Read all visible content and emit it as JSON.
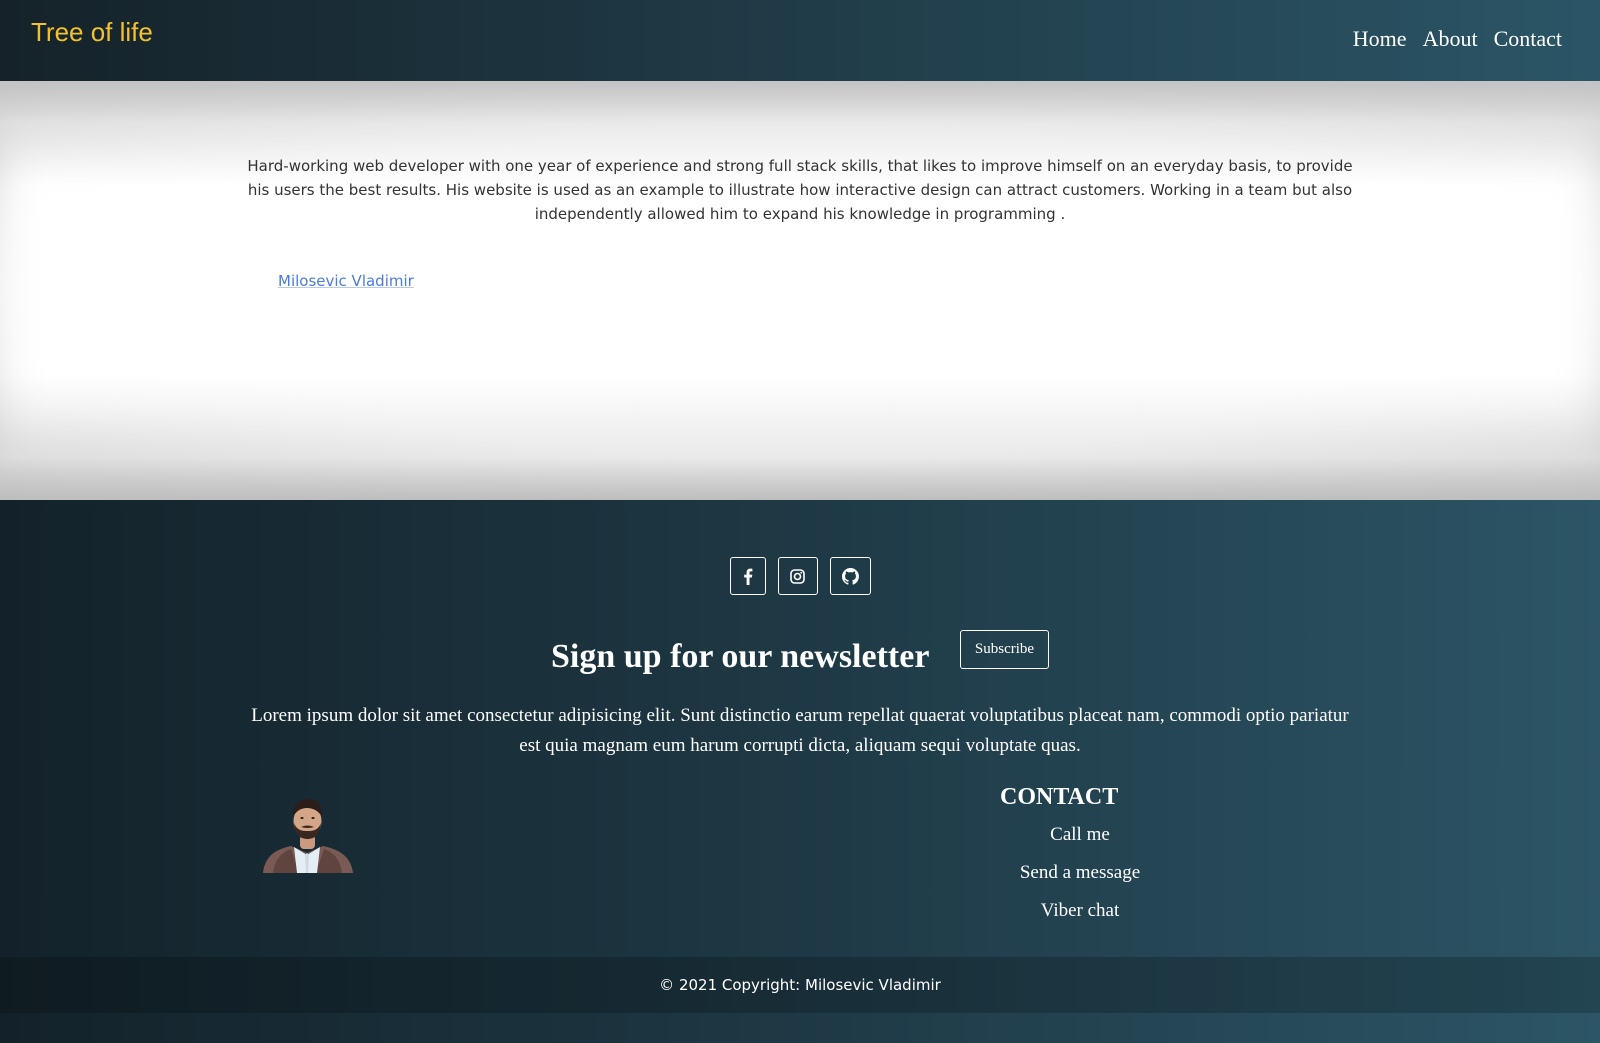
{
  "navbar": {
    "brand": "Tree of life",
    "links": [
      "Home",
      "About",
      "Contact"
    ]
  },
  "about": {
    "description": "Hard-working web developer with one year of experience and strong full stack skills, that likes to improve himself on an everyday basis, to provide his users the best results. His website is used as an example to illustrate how interactive design can attract customers. Working in a team but also independently allowed him to expand his knowledge in programming .",
    "author_link": "Milosevic Vladimir"
  },
  "footer": {
    "social_icons": [
      "facebook-icon",
      "instagram-icon",
      "github-icon"
    ],
    "newsletter_title": "Sign up for our newsletter",
    "subscribe_label": "Subscribe",
    "newsletter_text": "Lorem ipsum dolor sit amet consectetur adipisicing elit. Sunt distinctio earum repellat quaerat voluptatibus placeat nam, commodi optio pariatur est quia magnam eum harum corrupti dicta, aliquam sequi voluptate quas.",
    "contact_title": "CONTACT",
    "contact_items": [
      "Call me",
      "Send a message",
      "Viber chat"
    ],
    "copyright": "© 2021 Copyright: Milosevic Vladimir"
  },
  "colors": {
    "brand": "#f2c12e",
    "link": "#4b7be0",
    "footer_bg_start": "#13222a",
    "footer_bg_end": "#2c5566"
  }
}
